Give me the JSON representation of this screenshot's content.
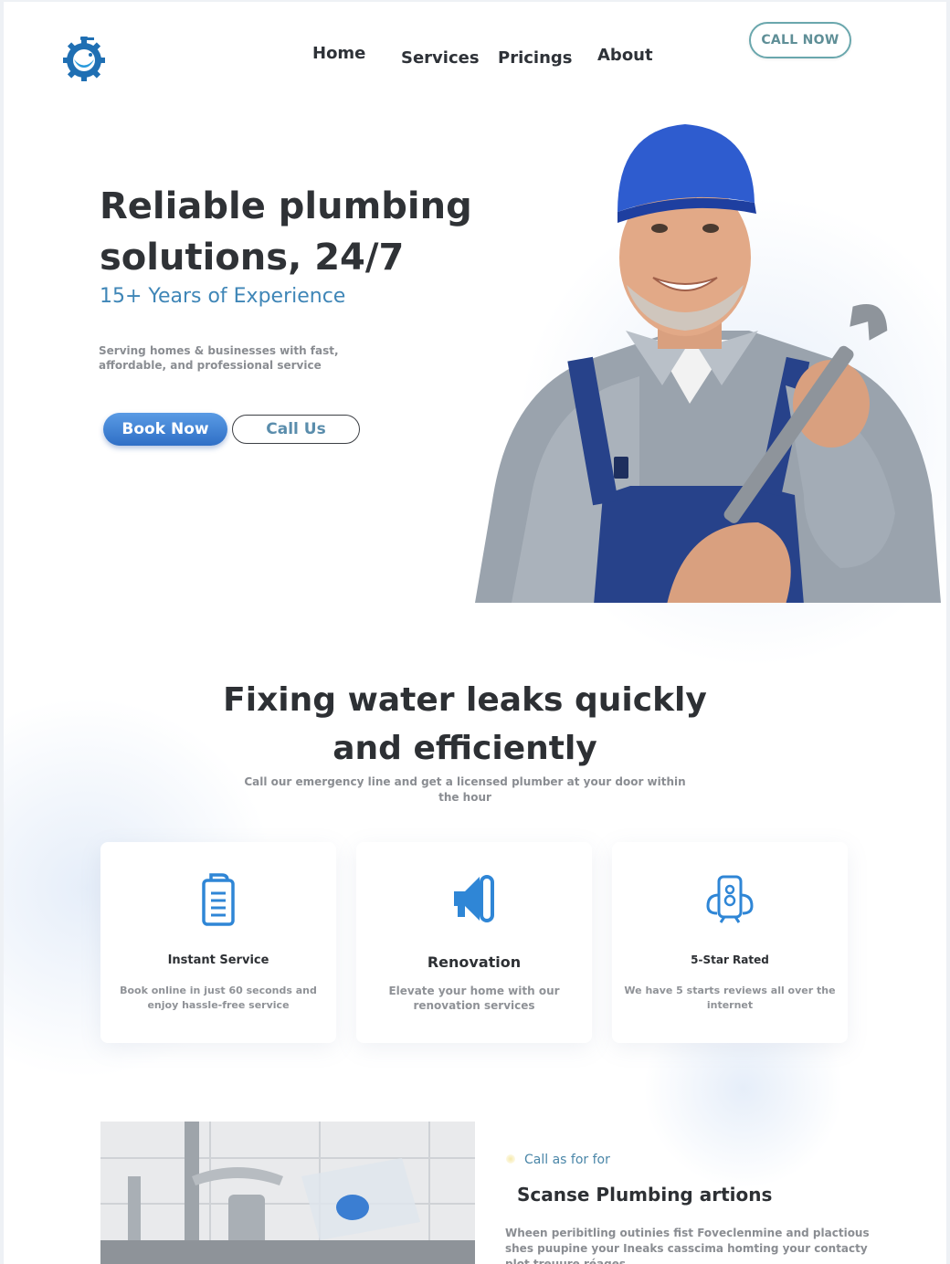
{
  "brand": {
    "logo_icon": "gear-wrench-logo-icon",
    "color": "#1f6fb3"
  },
  "nav": {
    "home": "Home",
    "services": "Services",
    "pricings": "Pricings",
    "about": "About",
    "cta": "CALL NOW"
  },
  "hero": {
    "title_line1": "Reliable plumbing",
    "title_line2": "solutions, 24/7",
    "subtitle": "15+ Years of Experience",
    "description": "Serving homes & businesses with fast, affordable, and professional service",
    "primary_button": "Book Now",
    "secondary_button": "Call Us"
  },
  "features": {
    "title_line1": "Fixing water leaks quickly",
    "title_line2": "and efficiently",
    "subtitle": "Call our emergency line and get a licensed plumber at your door within the hour",
    "cards": [
      {
        "icon": "clipboard-icon",
        "title": "Instant Service",
        "description": "Book online in just 60 seconds and enjoy hassle-free service"
      },
      {
        "icon": "megaphone-icon",
        "title": "Renovation",
        "description": "Elevate your home with our renovation services"
      },
      {
        "icon": "robot-phone-icon",
        "title": "5-Star Rated",
        "description": "We have 5 starts reviews all over the internet"
      }
    ]
  },
  "about_section": {
    "kicker": "Call as for for",
    "title": "Scanse Plumbing artions",
    "body": "Wheen peribitling outinies fist Foveclenmine and plactious shes puupine your Ineaks casscima homting your contacty plot treuure réages"
  },
  "colors": {
    "accent": "#3f86b7",
    "primary_button": "#2f6fc6",
    "heading": "#2f3236",
    "muted": "#8a8d92"
  }
}
